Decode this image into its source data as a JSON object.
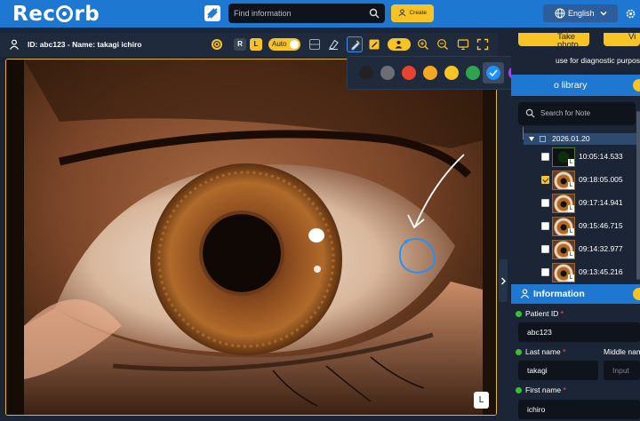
{
  "header": {
    "logo_text": "Recorb",
    "search_placeholder": "Find information",
    "create_label": "Create",
    "language": "English"
  },
  "toolbar": {
    "patient_label": "ID: abc123 - Name: takagi ichiro",
    "right_label": "R",
    "left_label": "L",
    "auto_label": "Auto"
  },
  "palette": {
    "colors": [
      "#222222",
      "#6b6f75",
      "#e8432e",
      "#f5a623",
      "#f7c325",
      "#2ea44f",
      "#1e90ff",
      "#a047f0",
      "#ffffff"
    ],
    "selected": "#1e90ff"
  },
  "viewer": {
    "eye_label": "L"
  },
  "right_panel": {
    "take_photo_label": "Take photo",
    "video_label": "Vi",
    "diagnostic_text": "use for diagnostic purpos",
    "library_title": "o library",
    "note_search_placeholder": "Search for Note",
    "date": "2026.01.20",
    "items": [
      {
        "time": "10:05:14.533",
        "checked": false,
        "eye": "L"
      },
      {
        "time": "09:18:05.005",
        "checked": true,
        "eye": "L"
      },
      {
        "time": "09:17:14.941",
        "checked": false,
        "eye": "L"
      },
      {
        "time": "09:15:46.715",
        "checked": false,
        "eye": "L"
      },
      {
        "time": "09:14:32.977",
        "checked": false,
        "eye": "L"
      },
      {
        "time": "09:13:45.216",
        "checked": false,
        "eye": "L"
      }
    ],
    "info_title": "Information",
    "patient_id_label": "Patient ID",
    "patient_id_value": "abc123",
    "last_name_label": "Last name",
    "last_name_value": "takagi",
    "middle_name_label": "Middle nam",
    "middle_name_placeholder": "Input",
    "first_name_label": "First name",
    "first_name_value": "ichiro",
    "required_mark": "*"
  }
}
